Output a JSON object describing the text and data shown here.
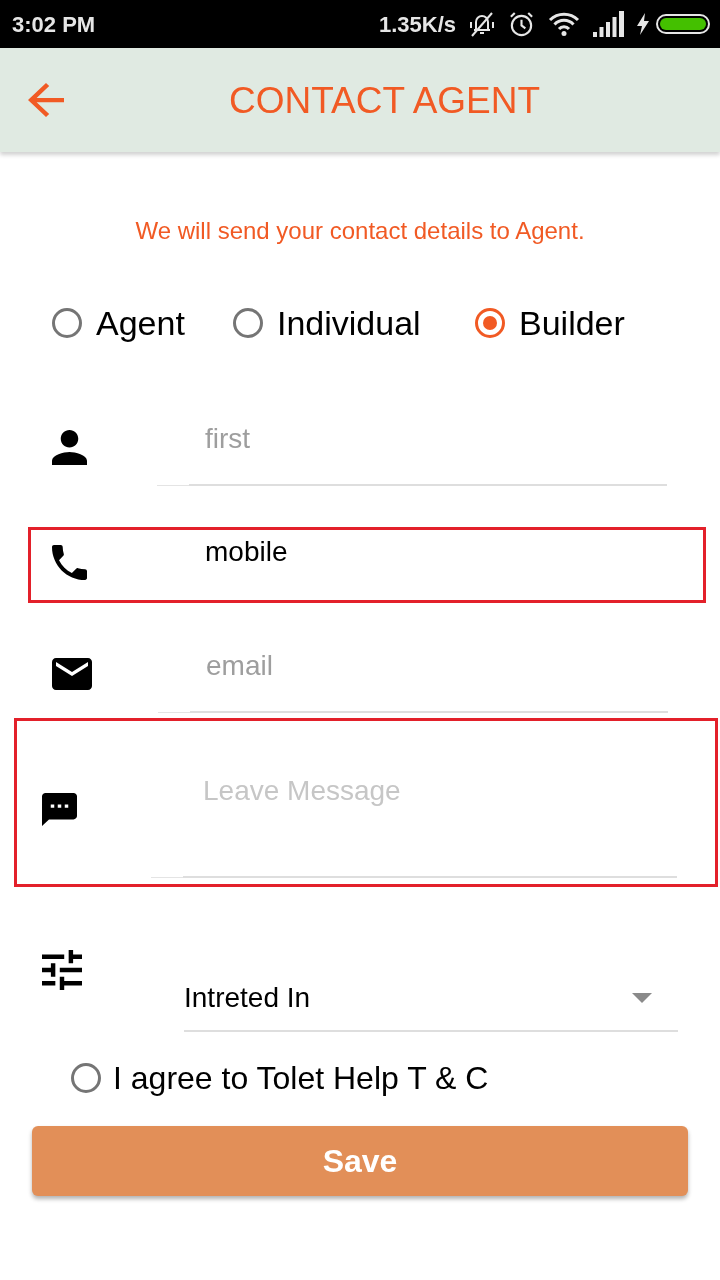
{
  "status_bar": {
    "time": "3:02 PM",
    "network_speed": "1.35K/s"
  },
  "header": {
    "title": "CONTACT AGENT"
  },
  "notice": "We will send your contact details to Agent.",
  "contact_types": [
    {
      "label": "Agent",
      "selected": false
    },
    {
      "label": "Individual",
      "selected": false
    },
    {
      "label": "Builder",
      "selected": true
    }
  ],
  "fields": [
    {
      "kind": "name",
      "placeholder": "first",
      "highlighted": false
    },
    {
      "kind": "phone",
      "value": "mobile",
      "highlighted": true
    },
    {
      "kind": "email",
      "placeholder": "email",
      "highlighted": false
    },
    {
      "kind": "message",
      "placeholder": "Leave Message",
      "highlighted": true
    }
  ],
  "interest_dropdown": {
    "value": "Intreted In"
  },
  "terms": {
    "label": "I agree to Tolet Help T & C",
    "checked": false
  },
  "save_button": {
    "label": "Save"
  }
}
